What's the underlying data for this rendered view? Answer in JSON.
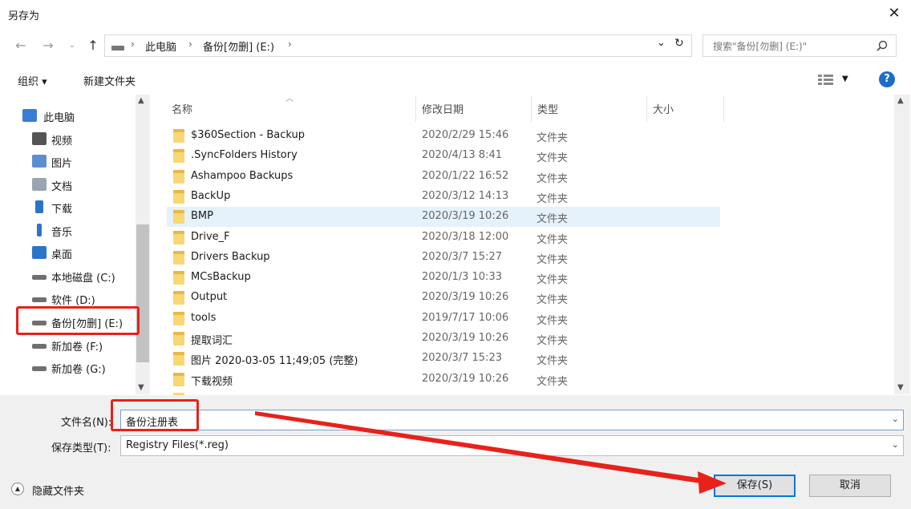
{
  "window": {
    "title": "另存为",
    "close_glyph": "✕"
  },
  "address": {
    "segments": [
      "此电脑",
      "备份[勿删] (E:)"
    ],
    "dropdown_glyph": "⌄",
    "refresh_glyph": "↻",
    "search_placeholder": "搜索\"备份[勿删] (E:)\""
  },
  "toolbar": {
    "organize": "组织 ▾",
    "new_folder": "新建文件夹",
    "help": "?"
  },
  "sidebar": {
    "items": [
      {
        "label": "此电脑",
        "icon": "computer-icon"
      },
      {
        "label": "视频",
        "icon": "video-icon"
      },
      {
        "label": "图片",
        "icon": "picture-icon"
      },
      {
        "label": "文档",
        "icon": "document-icon"
      },
      {
        "label": "下载",
        "icon": "download-icon"
      },
      {
        "label": "音乐",
        "icon": "music-icon"
      },
      {
        "label": "桌面",
        "icon": "desktop-icon"
      },
      {
        "label": "本地磁盘 (C:)",
        "icon": "drive-icon"
      },
      {
        "label": "软件 (D:)",
        "icon": "drive-icon"
      },
      {
        "label": "备份[勿删] (E:)",
        "icon": "drive-icon"
      },
      {
        "label": "新加卷 (F:)",
        "icon": "drive-icon"
      },
      {
        "label": "新加卷 (G:)",
        "icon": "drive-icon"
      }
    ]
  },
  "columns": {
    "name": "名称",
    "modified": "修改日期",
    "type": "类型",
    "size": "大小"
  },
  "files": [
    {
      "name": "$360Section - Backup",
      "date": "2020/2/29 15:46",
      "type": "文件夹"
    },
    {
      "name": ".SyncFolders History",
      "date": "2020/4/13 8:41",
      "type": "文件夹"
    },
    {
      "name": "Ashampoo Backups",
      "date": "2020/1/22 16:52",
      "type": "文件夹"
    },
    {
      "name": "BackUp",
      "date": "2020/3/12 14:13",
      "type": "文件夹"
    },
    {
      "name": "BMP",
      "date": "2020/3/19 10:26",
      "type": "文件夹"
    },
    {
      "name": "Drive_F",
      "date": "2020/3/18 12:00",
      "type": "文件夹"
    },
    {
      "name": "Drivers Backup",
      "date": "2020/3/7 15:27",
      "type": "文件夹"
    },
    {
      "name": "MCsBackup",
      "date": "2020/1/3 10:33",
      "type": "文件夹"
    },
    {
      "name": "Output",
      "date": "2020/3/19 10:26",
      "type": "文件夹"
    },
    {
      "name": "tools",
      "date": "2019/7/17 10:06",
      "type": "文件夹"
    },
    {
      "name": "提取词汇",
      "date": "2020/3/19 10:26",
      "type": "文件夹"
    },
    {
      "name": "图片 2020-03-05 11;49;05 (完整)",
      "date": "2020/3/7 15:23",
      "type": "文件夹"
    },
    {
      "name": "下载视频",
      "date": "2020/3/19 10:26",
      "type": "文件夹"
    }
  ],
  "form": {
    "filename_label": "文件名(N):",
    "filename_value": "备份注册表",
    "filetype_label": "保存类型(T):",
    "filetype_value": "Registry Files(*.reg)",
    "hide_folders": "隐藏文件夹",
    "save": "保存(S)",
    "cancel": "取消"
  },
  "colors": {
    "highlight": "#e8211a",
    "selected_row": "#e5f1fb",
    "accent": "#0078d7",
    "folder": "#f8d775"
  }
}
